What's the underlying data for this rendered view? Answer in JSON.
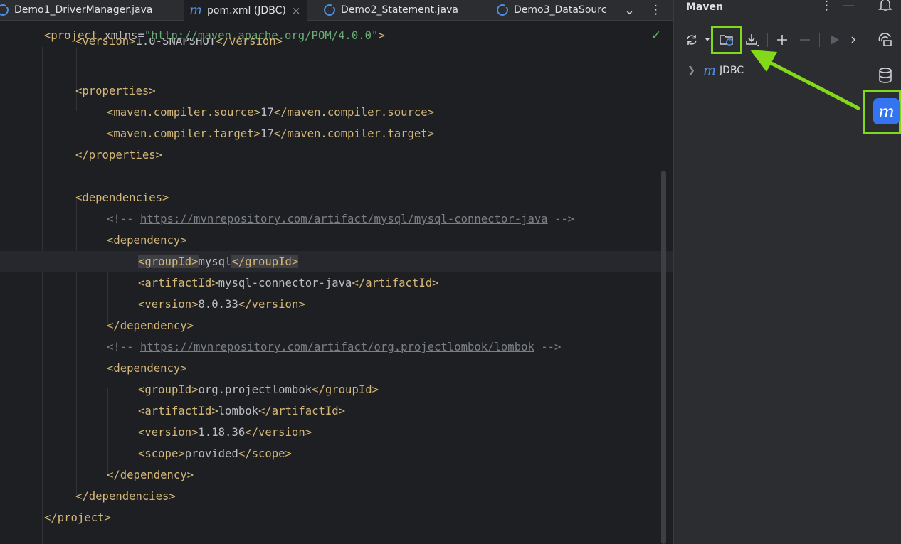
{
  "tabs": [
    {
      "label": "Demo1_DriverManager.java",
      "icon": "java-class-icon"
    },
    {
      "label": "pom.xml (JDBC)",
      "icon": "maven-m-icon",
      "active": true
    },
    {
      "label": "Demo2_Statement.java",
      "icon": "java-class-icon"
    },
    {
      "label": "Demo3_DataSourc",
      "icon": "java-class-icon"
    }
  ],
  "tab_tools": {
    "dropdown": "⌄",
    "more": "⋮",
    "close": "×"
  },
  "editor": {
    "line1": {
      "open": "<project ",
      "attr": "xmlns",
      "eq": "=",
      "value": "\"http://maven.apache.org/POM/4.0.0\"",
      "close": ">"
    },
    "line2": {
      "open": "<version>",
      "text": "1.0-SNAPSHOT",
      "close": "</version>"
    },
    "properties_open": "<properties>",
    "source": {
      "open": "<maven.compiler.source>",
      "text": "17",
      "close": "</maven.compiler.source>"
    },
    "target": {
      "open": "<maven.compiler.target>",
      "text": "17",
      "close": "</maven.compiler.target>"
    },
    "properties_close": "</properties>",
    "dependencies_open": "<dependencies>",
    "comment1": {
      "start": "<!-- ",
      "url": "https://mvnrepository.com/artifact/mysql/mysql-connector-java",
      "end": " -->"
    },
    "dep1_open": "<dependency>",
    "dep1_group": {
      "open": "<groupId>",
      "text": "mysql",
      "close": "</groupId>"
    },
    "dep1_artifact": {
      "open": "<artifactId>",
      "text": "mysql-connector-java",
      "close": "</artifactId>"
    },
    "dep1_version": {
      "open": "<version>",
      "text": "8.0.33",
      "close": "</version>"
    },
    "dep1_close": "</dependency>",
    "comment2": {
      "start": "<!-- ",
      "url": "https://mvnrepository.com/artifact/org.projectlombok/lombok",
      "end": " -->"
    },
    "dep2_open": "<dependency>",
    "dep2_group": {
      "open": "<groupId>",
      "text": "org.projectlombok",
      "close": "</groupId>"
    },
    "dep2_artifact": {
      "open": "<artifactId>",
      "text": "lombok",
      "close": "</artifactId>"
    },
    "dep2_version": {
      "open": "<version>",
      "text": "1.18.36",
      "close": "</version>"
    },
    "dep2_scope": {
      "open": "<scope>",
      "text": "provided",
      "close": "</scope>"
    },
    "dep2_close": "</dependency>",
    "dependencies_close": "</dependencies>",
    "project_close": "</project>"
  },
  "maven": {
    "title": "Maven",
    "more": "⋮",
    "minimize": "—",
    "tree": [
      {
        "label": "JDBC",
        "icon": "maven-m-icon",
        "expanded": false
      }
    ]
  },
  "right_strip": {
    "items": [
      "notifications-icon",
      "ai-assistant-icon",
      "database-icon",
      "maven-icon"
    ],
    "maven_letter": "m"
  },
  "colors": {
    "highlight": "#84d81a",
    "accent": "#3574f0",
    "tag": "#d5b778",
    "string": "#6aab73",
    "comment": "#7a7e85"
  }
}
